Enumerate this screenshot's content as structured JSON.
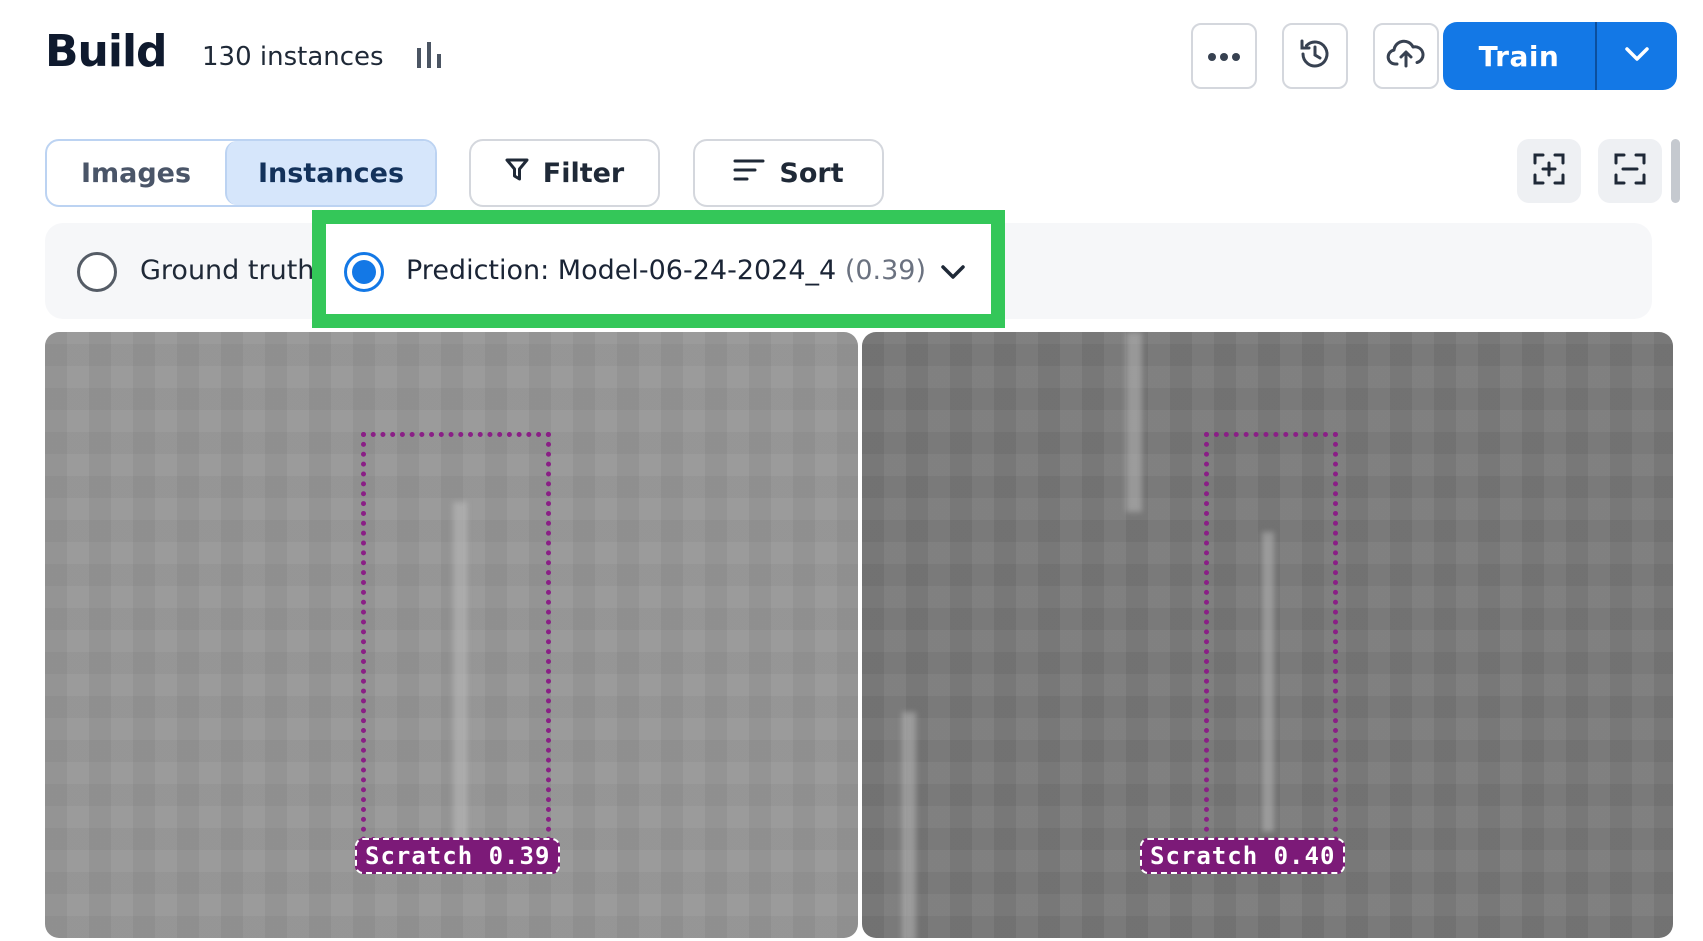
{
  "header": {
    "title": "Build",
    "instance_count": "130 instances",
    "train_label": "Train"
  },
  "icons": {
    "stats": "bar-chart-icon",
    "more": "more-horizontal-icon",
    "history": "history-icon",
    "upload": "cloud-upload-icon",
    "train_dropdown": "chevron-down-icon",
    "filter": "filter-icon",
    "sort": "sort-icon",
    "zoom_in": "add-frame-icon",
    "zoom_out": "remove-frame-icon"
  },
  "toolbar": {
    "tabs": [
      {
        "label": "Images",
        "selected": false
      },
      {
        "label": "Instances",
        "selected": true
      }
    ],
    "filter_label": "Filter",
    "sort_label": "Sort"
  },
  "source": {
    "ground_truth_label": "Ground truth",
    "prediction_label": "Prediction: Model-06-24-2024_4",
    "prediction_score": "(0.39)",
    "selected": "prediction"
  },
  "tiles": [
    {
      "label": "Scratch 0.39"
    },
    {
      "label": "Scratch 0.40"
    }
  ],
  "colors": {
    "primary": "#1378e6",
    "highlight": "#34c759",
    "annotation": "#7c1a78"
  }
}
